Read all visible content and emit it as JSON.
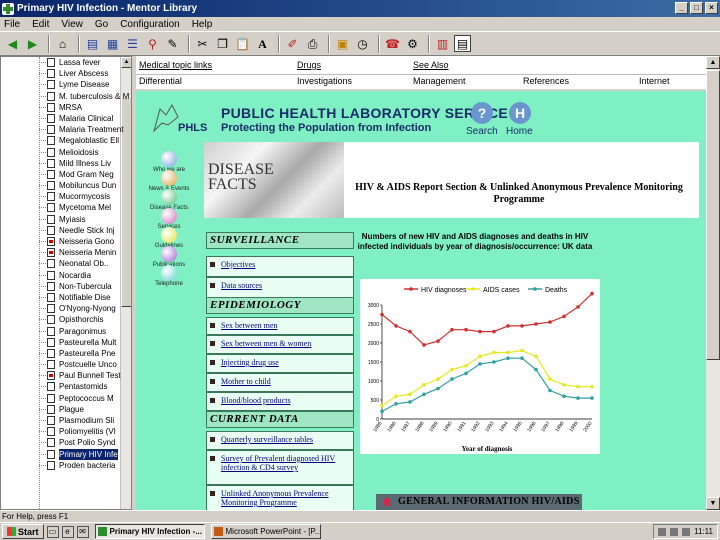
{
  "window": {
    "title": "Primary HIV Infection - Mentor Library"
  },
  "menu": [
    "File",
    "Edit",
    "View",
    "Go",
    "Configuration",
    "Help"
  ],
  "toolbar_icons": [
    "back-icon",
    "forward-icon",
    "home-icon",
    "contents-icon",
    "library-icon",
    "index-icon",
    "search-tool-icon",
    "bookmark-icon",
    "cut-icon",
    "copy-icon",
    "paste-icon",
    "font-icon",
    "edit-icon",
    "print-icon",
    "notes-icon",
    "history-icon",
    "fax-icon",
    "options-icon",
    "frames-icon",
    "layout-icon"
  ],
  "tree": {
    "items": [
      {
        "label": "Lassa fever",
        "red": false
      },
      {
        "label": "Liver Abscess",
        "red": false
      },
      {
        "label": "Lyme Disease",
        "red": false
      },
      {
        "label": "M. tuberculosis & M",
        "red": false
      },
      {
        "label": "MRSA",
        "red": false
      },
      {
        "label": "Malaria Clinical",
        "red": false
      },
      {
        "label": "Malaria Treatment",
        "red": false
      },
      {
        "label": "Megaloblastic Ell",
        "red": false
      },
      {
        "label": "Melioidosis",
        "red": false
      },
      {
        "label": "Mild Illness Liv",
        "red": false
      },
      {
        "label": "Mod Gram Neg",
        "red": false
      },
      {
        "label": "Mobiluncus Dun",
        "red": false
      },
      {
        "label": "Mucormycosis",
        "red": false
      },
      {
        "label": "Mycetoma Mel",
        "red": false
      },
      {
        "label": "Myiasis",
        "red": false
      },
      {
        "label": "Needle Stick Inj",
        "red": false
      },
      {
        "label": "Neisseria Gono",
        "red": true
      },
      {
        "label": "Neisseria Menin",
        "red": true
      },
      {
        "label": "Neonatal Ob..",
        "red": false
      },
      {
        "label": "Nocardia",
        "red": false
      },
      {
        "label": "Non-Tubercula",
        "red": false
      },
      {
        "label": "Notifiable Dise",
        "red": false
      },
      {
        "label": "O'Nyong-Nyong",
        "red": false
      },
      {
        "label": "Opisthorchis",
        "red": false
      },
      {
        "label": "Paragonimus",
        "red": false
      },
      {
        "label": "Pasteurella Mult",
        "red": false
      },
      {
        "label": "Pasteurella Pne",
        "red": false
      },
      {
        "label": "Postcuelle Unco",
        "red": false
      },
      {
        "label": "Paul Bunnell Test",
        "red": true
      },
      {
        "label": "Pentastomids",
        "red": false
      },
      {
        "label": "Peptococcus M",
        "red": false
      },
      {
        "label": "Plague",
        "red": false
      },
      {
        "label": "Plasmodium Sli",
        "red": false
      },
      {
        "label": "Poliomyelitis (VI",
        "red": false
      },
      {
        "label": "Post Polio Synd",
        "red": false
      },
      {
        "label": "Primary HIV Infe",
        "red": false,
        "selected": true
      },
      {
        "label": "Proden bacteria",
        "red": false
      }
    ]
  },
  "links": {
    "row1": [
      "Medical topic links",
      "Drugs",
      "See Also"
    ],
    "row2": [
      "Differential",
      "Investigations",
      "Management",
      "References",
      "Internet"
    ]
  },
  "content": {
    "org_title": "PUBLIC HEALTH LABORATORY SERVICE",
    "org_subtitle": "Protecting the Population from Infection",
    "logo_text": "PHLS",
    "search_label": "Search",
    "home_label": "Home",
    "search_glyph": "?",
    "home_glyph": "H",
    "side_nav": [
      {
        "label": "Who we are",
        "color": "#7aa0e0"
      },
      {
        "label": "News & Events",
        "color": "#e0a040"
      },
      {
        "label": "Disease Facts",
        "color": "#50c070"
      },
      {
        "label": "Services",
        "color": "#d070c0"
      },
      {
        "label": "Guidelines",
        "color": "#e0e040"
      },
      {
        "label": "Publications",
        "color": "#a060d0"
      },
      {
        "label": "Telephone",
        "color": "#60d0d0"
      }
    ],
    "banner_text": "DISEASE FACTS",
    "banner_title": "HIV & AIDS Report Section & Unlinked Anonymous Prevalence Monitoring Programme",
    "sections": [
      {
        "heading": "SURVEILLANCE",
        "items": [
          "Objectives",
          "Data sources"
        ]
      },
      {
        "heading": "EPIDEMIOLOGY",
        "items": [
          "Sex between men",
          "Sex between men & women",
          "Injecting drug use",
          "Mother to child",
          "Blood/blood products"
        ]
      },
      {
        "heading": "CURRENT DATA",
        "items": [
          "Quarterly surveillance tables",
          "Survey of Prevalent diagnosed HIV infection & CD4 survey",
          "Unlinked Anonymous Prevalence Monitoring Programme"
        ]
      }
    ],
    "chart_title": "Numbers of new HIV and AIDS diagnoses and deaths in HIV infected individuals by year of diagnosis/occurrence: UK data",
    "general_info": "GENERAL INFORMATION HIV/AIDS"
  },
  "chart_data": {
    "type": "line",
    "xlabel": "Year of diagnosis",
    "ylabel": "",
    "x": [
      "1985",
      "1986",
      "1987",
      "1988",
      "1989",
      "1990",
      "1991",
      "1992",
      "1993",
      "1994",
      "1995",
      "1996",
      "1997",
      "1998",
      "1999",
      "2000"
    ],
    "ylim": [
      0,
      3000
    ],
    "yticks": [
      0,
      500,
      1000,
      1500,
      2000,
      2500,
      3000
    ],
    "legend": "top",
    "grid": false,
    "series": [
      {
        "name": "HIV diagnoses",
        "color": "#d03030",
        "values": [
          2750,
          2450,
          2300,
          1950,
          2050,
          2350,
          2350,
          2300,
          2300,
          2450,
          2450,
          2500,
          2550,
          2700,
          2950,
          3300
        ]
      },
      {
        "name": "AIDS cases",
        "color": "#e8e820",
        "values": [
          350,
          600,
          650,
          900,
          1050,
          1300,
          1400,
          1650,
          1750,
          1750,
          1800,
          1650,
          1050,
          900,
          850,
          850
        ]
      },
      {
        "name": "Deaths",
        "color": "#30a0a0",
        "values": [
          200,
          400,
          450,
          650,
          800,
          1050,
          1200,
          1450,
          1500,
          1600,
          1600,
          1300,
          750,
          600,
          550,
          550
        ]
      }
    ]
  },
  "status": {
    "text": "For Help, press F1"
  },
  "taskbar": {
    "start": "Start",
    "tasks": [
      "Primary HIV Infection -...",
      "Microsoft PowerPoint - [P..."
    ],
    "clock": "11:11"
  }
}
